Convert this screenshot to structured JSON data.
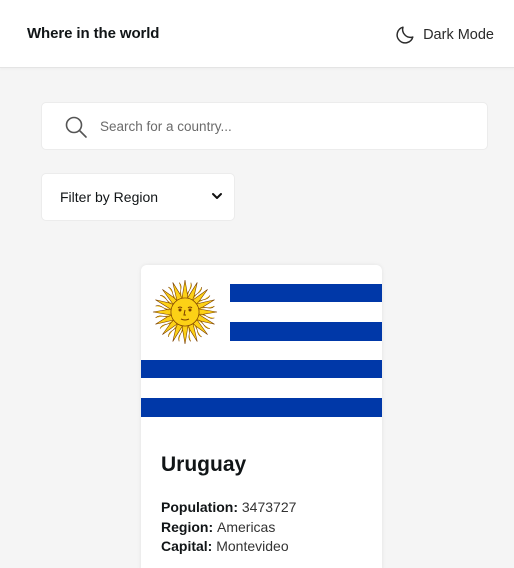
{
  "header": {
    "title": "Where in the world",
    "theme_toggle_label": "Dark Mode",
    "theme_icon": "moon-icon"
  },
  "search": {
    "placeholder": "Search for a country...",
    "value": "",
    "icon": "search-icon"
  },
  "filter": {
    "label": "Filter by Region",
    "icon": "chevron-down-icon"
  },
  "countries": [
    {
      "name": "Uruguay",
      "flag": "uruguay-flag",
      "population_label": "Population:",
      "population": "3473727",
      "region_label": "Region:",
      "region": "Americas",
      "capital_label": "Capital:",
      "capital": "Montevideo"
    }
  ],
  "colors": {
    "page_background": "#f5f5f5",
    "surface": "#ffffff",
    "text": "#111517",
    "flag_blue": "#0038a8",
    "sun_gold": "#fcd116",
    "sun_outline": "#7b3f00"
  }
}
